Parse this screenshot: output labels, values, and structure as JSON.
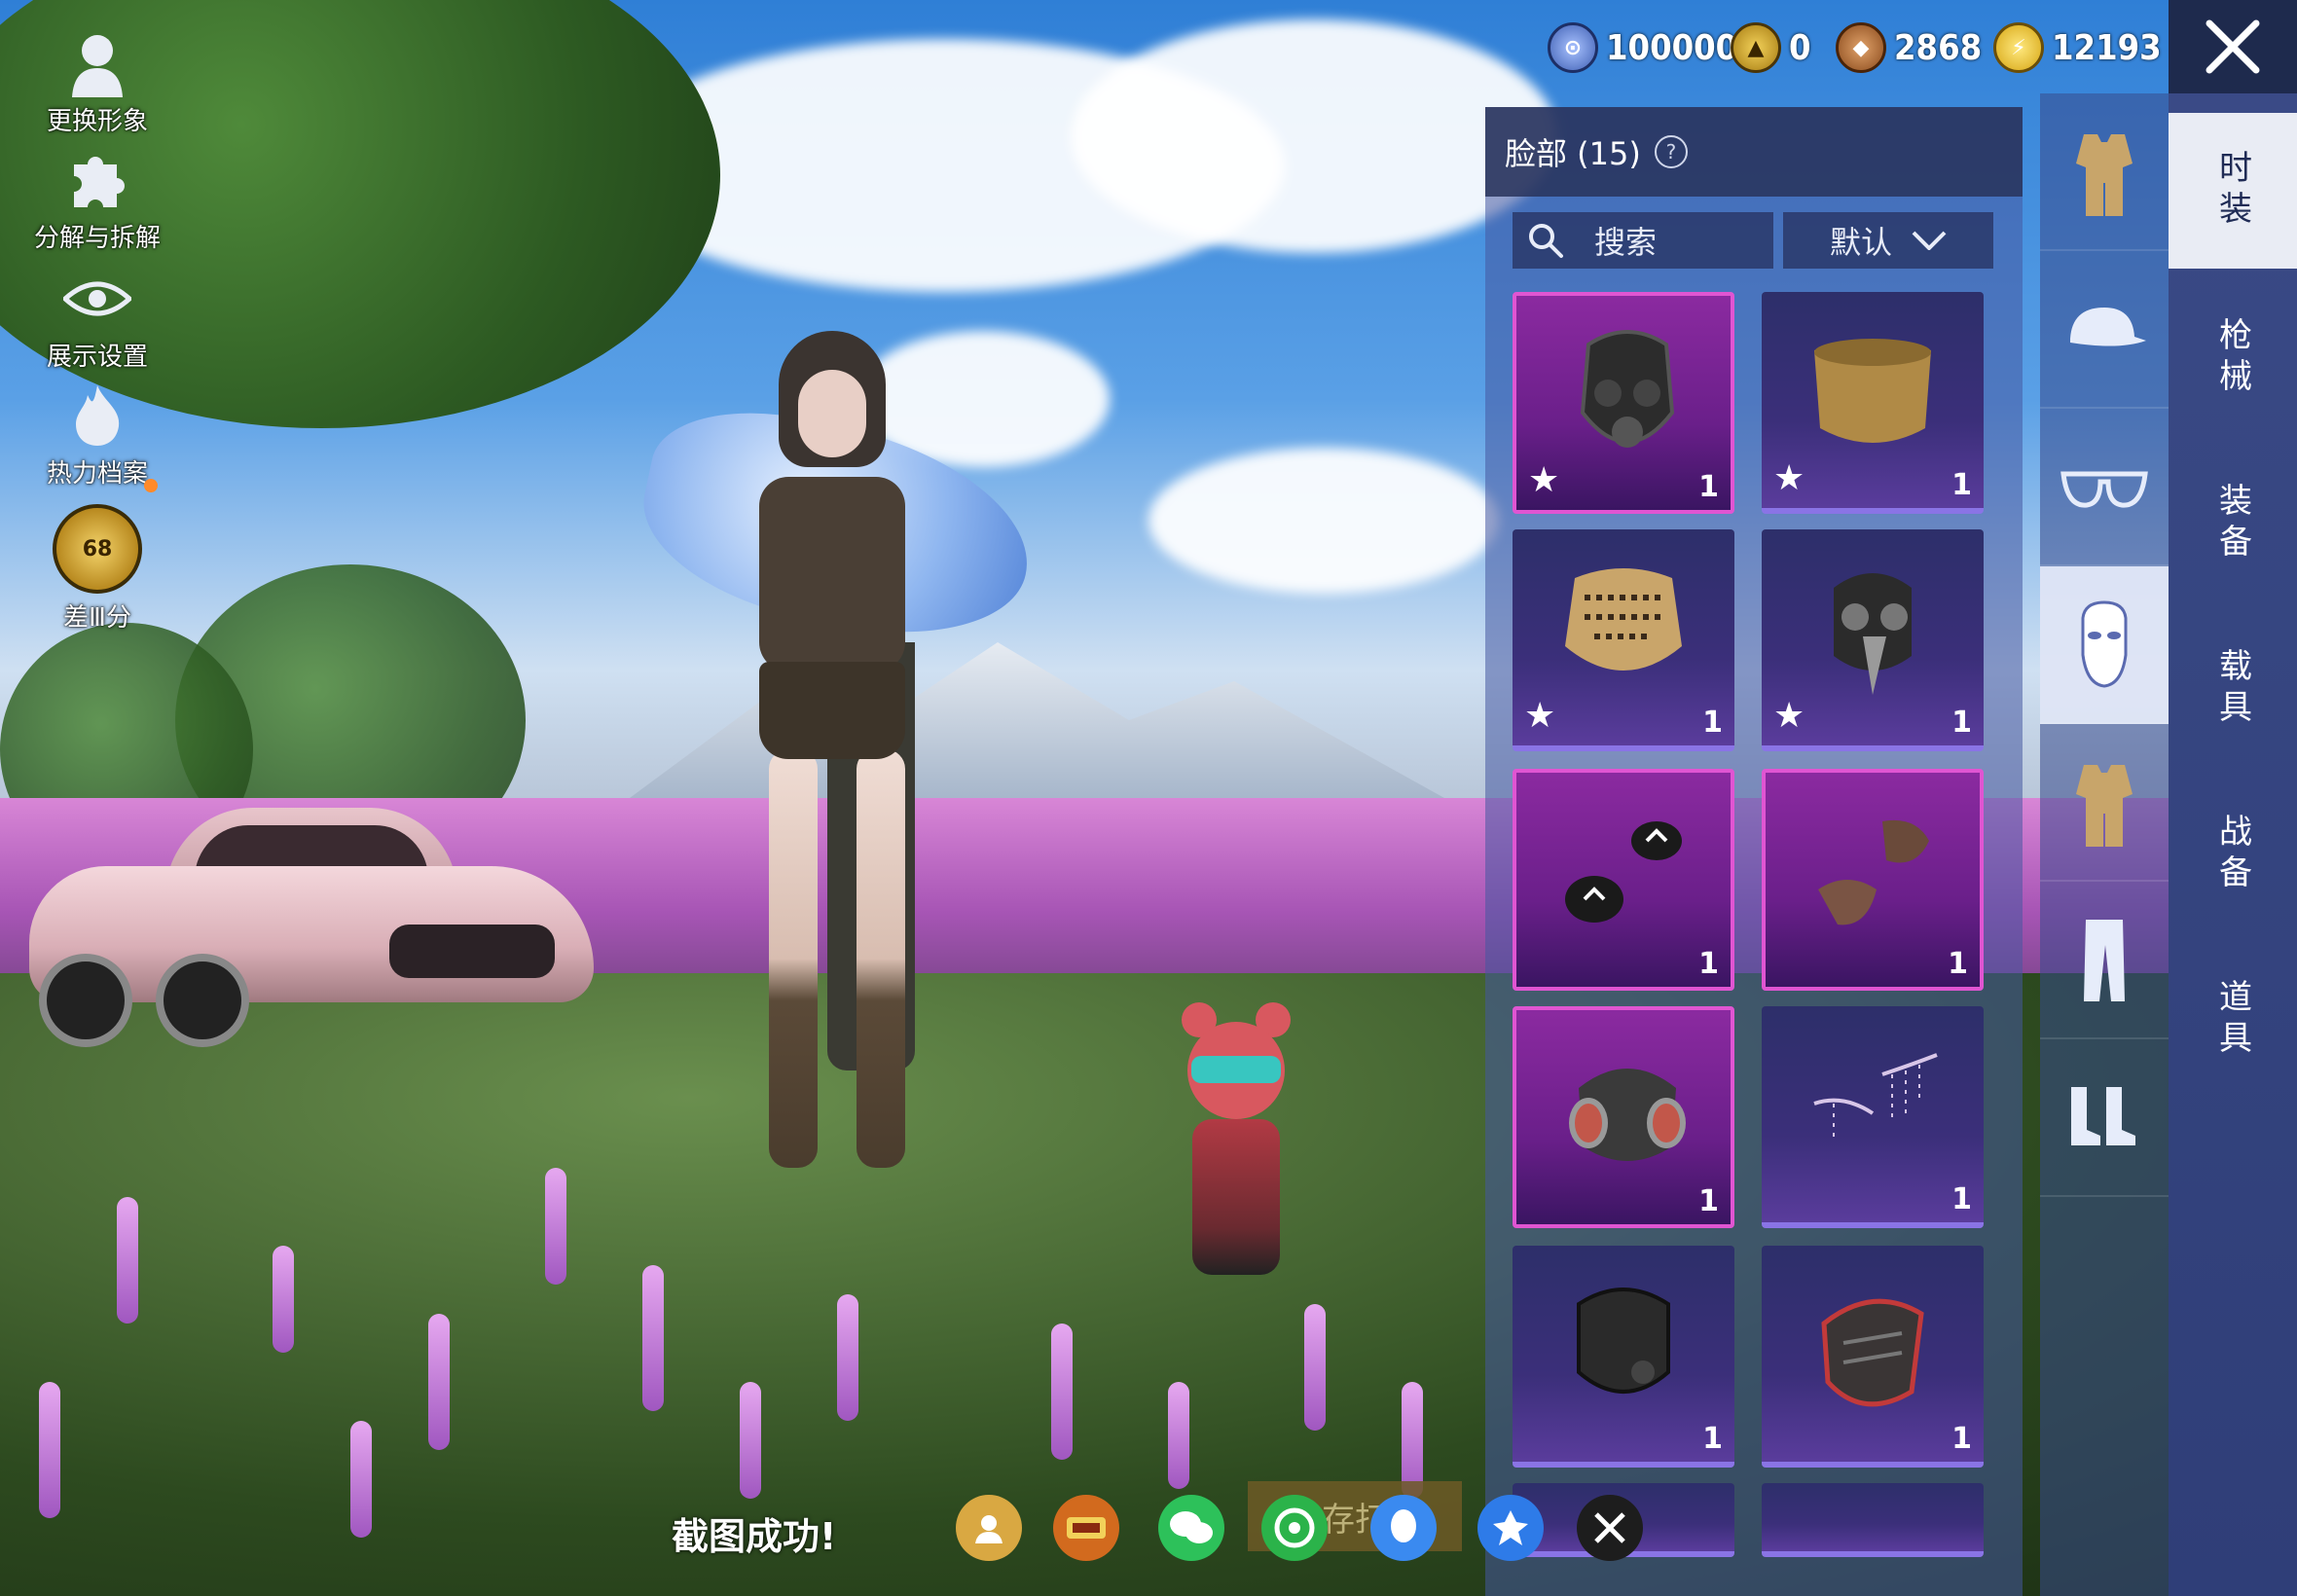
{
  "left_menu": {
    "change_look": "更换形象",
    "decompose": "分解与拆解",
    "display_settings": "展示设置",
    "heat_archive": "热力档案",
    "rank_level": "68",
    "rank_text": "差Ⅲ分"
  },
  "currencies": [
    {
      "name": "coupon-a",
      "value": "100000",
      "color": "#5a7fd6"
    },
    {
      "name": "coupon-b",
      "value": "0",
      "color": "#d6a832"
    },
    {
      "name": "coupon-c",
      "value": "2868",
      "color": "#b86a2e"
    },
    {
      "name": "coupon-d",
      "value": "12193",
      "color": "#e6c12e"
    }
  ],
  "panel": {
    "title": "脸部 (15)",
    "search_label": "搜索",
    "sort_label": "默认"
  },
  "items": [
    {
      "rarity": "pink",
      "star": true,
      "qty": "1",
      "icon": "gas-mask-icon"
    },
    {
      "rarity": "purple",
      "star": true,
      "qty": "1",
      "icon": "neck-gaiter-icon"
    },
    {
      "rarity": "purple",
      "star": true,
      "qty": "1",
      "icon": "shemagh-scarf-icon"
    },
    {
      "rarity": "purple",
      "star": true,
      "qty": "1",
      "icon": "plague-doctor-mask-icon"
    },
    {
      "rarity": "pink",
      "star": false,
      "qty": "1",
      "icon": "fang-mask-icon"
    },
    {
      "rarity": "pink",
      "star": false,
      "qty": "1",
      "icon": "leather-mask-icon"
    },
    {
      "rarity": "pink",
      "star": false,
      "qty": "1",
      "icon": "respirator-icon"
    },
    {
      "rarity": "purple",
      "star": false,
      "qty": "1",
      "icon": "face-chain-icon"
    },
    {
      "rarity": "purple",
      "star": false,
      "qty": "1",
      "icon": "black-mask-icon"
    },
    {
      "rarity": "purple",
      "star": false,
      "qty": "1",
      "icon": "red-armor-mask-icon"
    }
  ],
  "category_icons": [
    "outfit-icon",
    "cap-icon",
    "glasses-icon",
    "face-mask-icon",
    "outfit-icon",
    "pants-icon",
    "boots-icon"
  ],
  "right_tabs": [
    {
      "label": "时装",
      "active": true
    },
    {
      "label": "枪械",
      "active": false
    },
    {
      "label": "装备",
      "active": false
    },
    {
      "label": "载具",
      "active": false
    },
    {
      "label": "战备",
      "active": false
    },
    {
      "label": "道具",
      "active": false
    }
  ],
  "bottom": {
    "screenshot_msg": "截图成功!",
    "save_label": "存打",
    "share_icons": [
      "profile-share-icon",
      "peace-elite-icon",
      "wechat-icon",
      "moments-icon",
      "qq-icon",
      "qzone-icon",
      "game-share-icon"
    ]
  }
}
